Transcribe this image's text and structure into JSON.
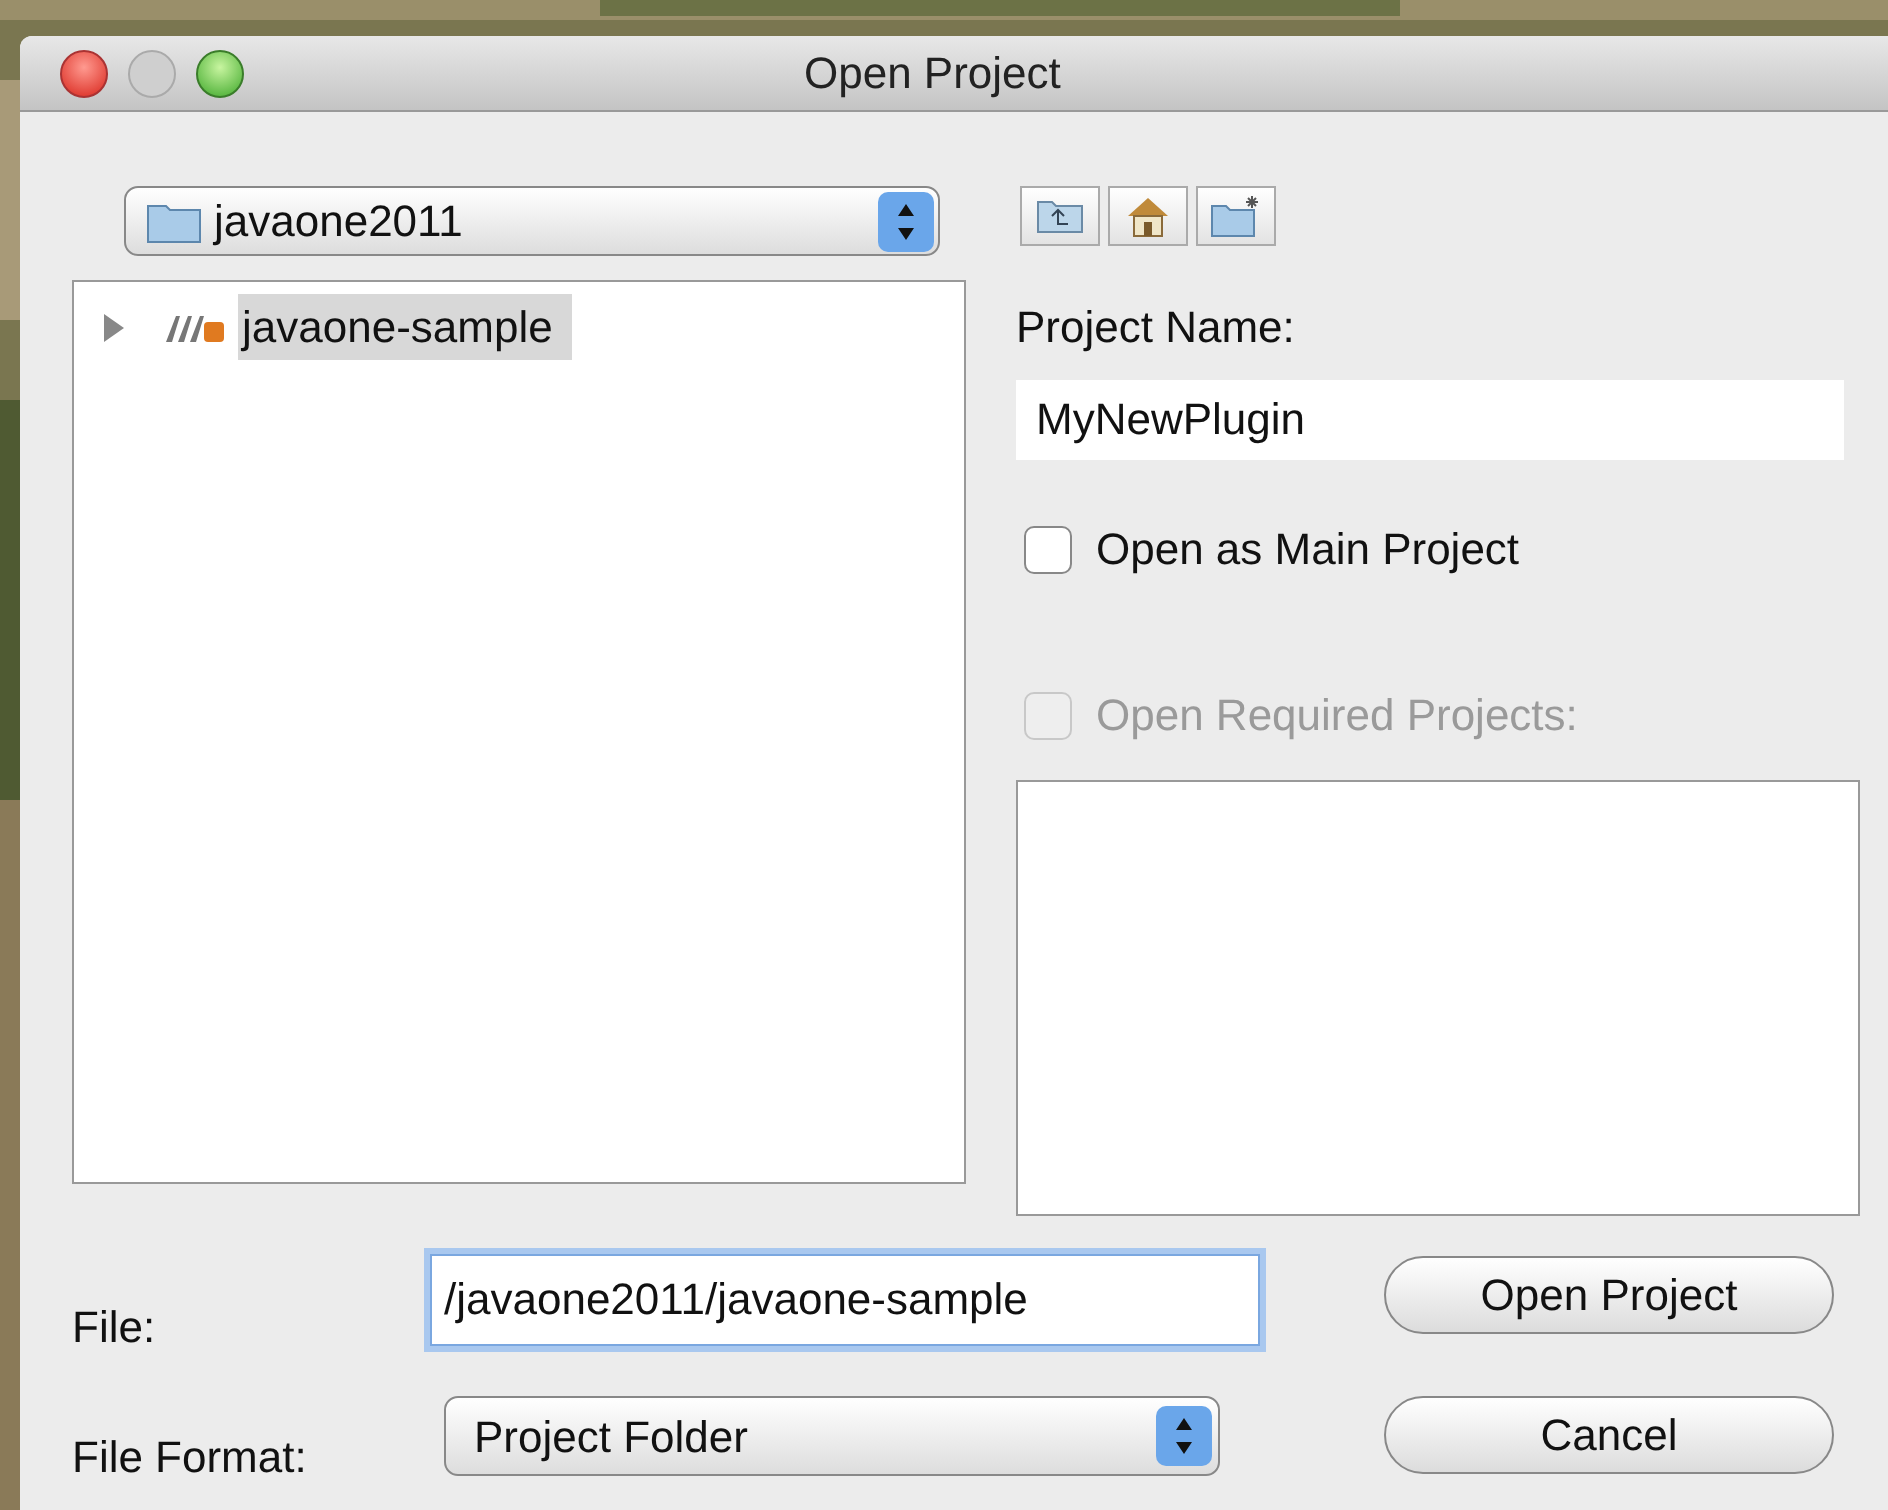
{
  "window": {
    "title": "Open Project"
  },
  "folder_combo": {
    "value": "javaone2011"
  },
  "tree": [
    {
      "label": "javaone-sample",
      "expanded": false,
      "selected": true
    }
  ],
  "project_name": {
    "label": "Project Name:",
    "value": "MyNewPlugin"
  },
  "options": [
    {
      "label": "Open as Main Project",
      "checked": false,
      "disabled": false
    },
    {
      "label": "Open Required Projects:",
      "checked": false,
      "disabled": true
    }
  ],
  "file": {
    "label": "File:",
    "value": "/javaone2011/javaone-sample",
    "focused": true
  },
  "file_format": {
    "label": "File Format:",
    "value": "Project Folder"
  },
  "buttons": [
    "Open Project",
    "Cancel"
  ]
}
